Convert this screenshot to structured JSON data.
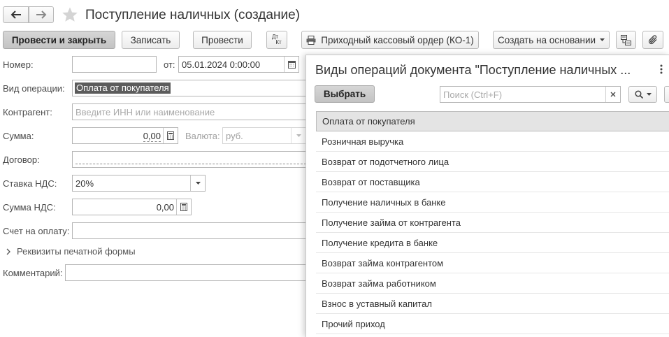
{
  "header": {
    "title": "Поступление наличных (создание)",
    "nav_back_icon": "arrow-left-icon",
    "nav_forward_icon": "arrow-right-icon",
    "favorite_icon": "star-icon"
  },
  "toolbar": {
    "post_close": "Провести и закрыть",
    "save": "Записать",
    "post": "Провести",
    "dt_kt_top": "Дт",
    "dt_kt_bottom": "Кт",
    "print_order": "Приходный кассовый ордер (КО-1)",
    "create_based": "Создать на основании"
  },
  "form": {
    "number_label": "Номер:",
    "number_value": "",
    "from_label": "от:",
    "date_value": "05.01.2024  0:00:00",
    "operation_label": "Вид операции:",
    "operation_value": "Оплата от покупателя",
    "counterparty_label": "Контрагент:",
    "counterparty_placeholder": "Введите ИНН или наименование",
    "amount_label": "Сумма:",
    "amount_value": "0,00",
    "currency_label": "Валюта:",
    "currency_value": "руб.",
    "contract_label": "Договор:",
    "vat_rate_label": "Ставка НДС:",
    "vat_rate_value": "20%",
    "vat_amount_label": "Сумма НДС:",
    "vat_amount_value": "0,00",
    "invoice_label": "Счет на оплату:",
    "print_details_label": "Реквизиты печатной формы",
    "comment_label": "Комментарий:"
  },
  "popup": {
    "title": "Виды операций документа \"Поступление наличных ...",
    "select_button": "Выбрать",
    "search_placeholder": "Поиск (Ctrl+F)",
    "items": [
      "Оплата от покупателя",
      "Розничная выручка",
      "Возврат от подотчетного лица",
      "Возврат от поставщика",
      "Получение наличных в банке",
      "Получение займа от контрагента",
      "Получение кредита в банке",
      "Возврат займа контрагентом",
      "Возврат займа работником",
      "Взнос в уставный капитал",
      "Прочий приход"
    ],
    "selected_index": 0
  }
}
